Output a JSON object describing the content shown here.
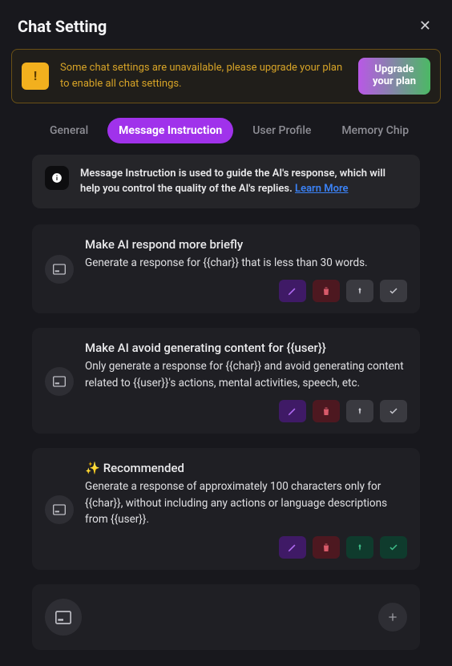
{
  "header": {
    "title": "Chat Setting"
  },
  "banner": {
    "badge": "!",
    "text": "Some chat settings are unavailable, please upgrade your plan to enable all chat settings.",
    "upgrade_label": "Upgrade your plan"
  },
  "tabs": {
    "general": "General",
    "message_instruction": "Message Instruction",
    "user_profile": "User Profile",
    "memory_chip": "Memory Chip"
  },
  "info": {
    "text": "Message Instruction is used to guide the AI's response, which will help you control the quality of the AI's replies. ",
    "learn_more": "Learn More"
  },
  "cards": [
    {
      "title": "Make AI respond more briefly",
      "desc": "Generate a response for {{char}} that is less than 30 words.",
      "recommended": false,
      "pinned": false,
      "checked": false
    },
    {
      "title": "Make AI avoid generating content for {{user}}",
      "desc": "Only generate a response for {{char}} and avoid generating content related to {{user}}'s actions, mental activities, speech, etc.",
      "recommended": false,
      "pinned": false,
      "checked": false
    },
    {
      "title": "Recommended",
      "desc": "Generate a response of approximately 100 characters only for {{char}}, without including any actions or language descriptions from {{user}}.",
      "recommended": true,
      "pinned": true,
      "checked": true
    }
  ]
}
